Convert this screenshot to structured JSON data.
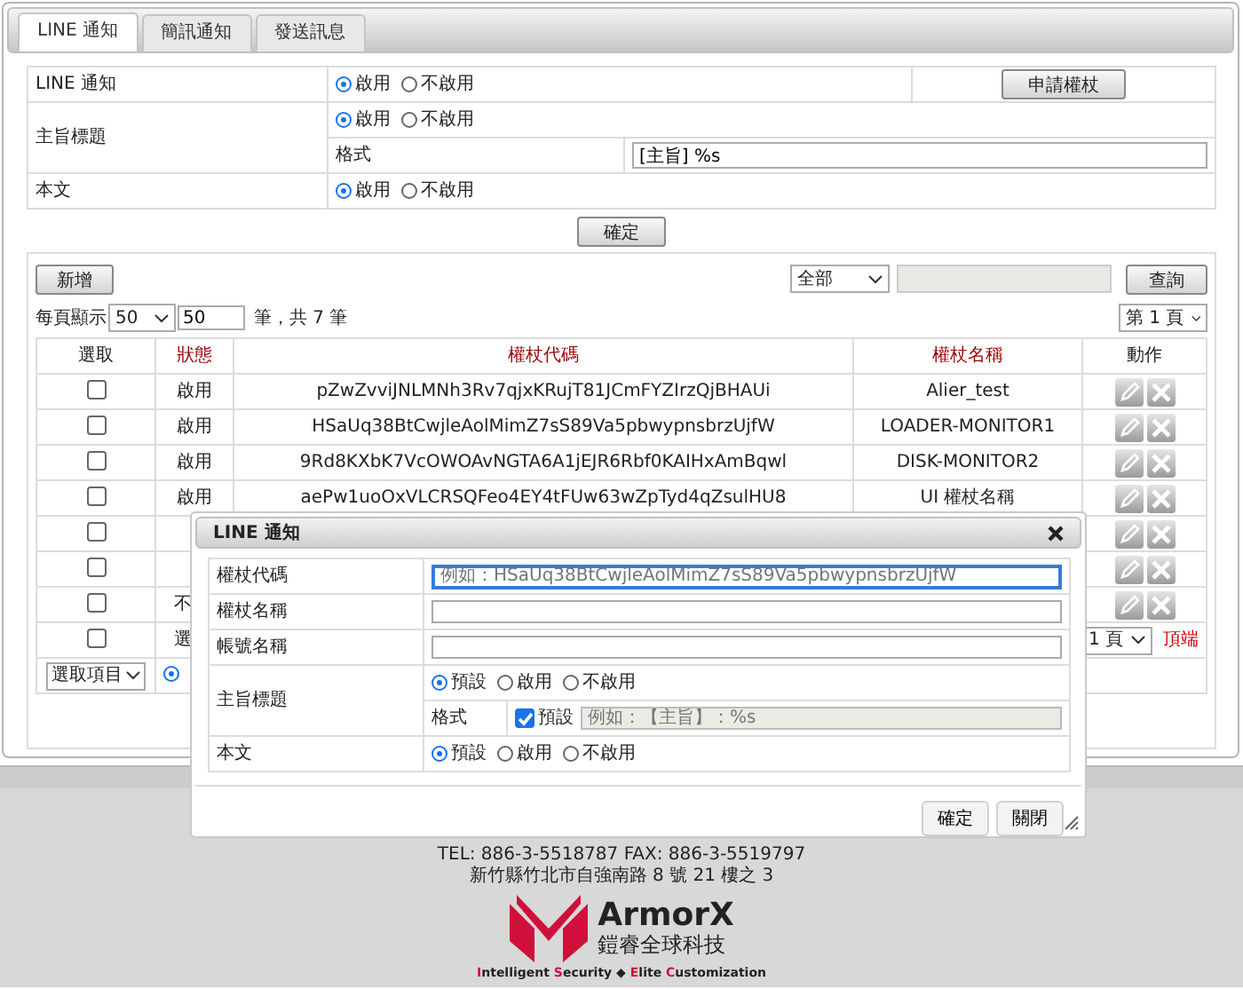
{
  "tabs": [
    {
      "label": "LINE 通知",
      "selected": true
    },
    {
      "label": "簡訊通知",
      "selected": false
    },
    {
      "label": "發送訊息",
      "selected": false
    }
  ],
  "settings": {
    "line_notify": {
      "label": "LINE 通知",
      "options": [
        {
          "label": "啟用",
          "selected": true
        },
        {
          "label": "不啟用",
          "selected": false
        }
      ],
      "button": "申請權杖"
    },
    "subject": {
      "label": "主旨標題",
      "options": [
        {
          "label": "啟用",
          "selected": true
        },
        {
          "label": "不啟用",
          "selected": false
        }
      ],
      "format_label": "格式",
      "format_value": "[主旨] %s"
    },
    "body": {
      "label": "本文",
      "options": [
        {
          "label": "啟用",
          "selected": true
        },
        {
          "label": "不啟用",
          "selected": false
        }
      ]
    },
    "submit": "確定"
  },
  "toolbar": {
    "add": "新增",
    "filter": "全部",
    "query": "查詢"
  },
  "paging": {
    "per_page_label": "每頁顯示",
    "per_page": "50",
    "per_page_input": "50",
    "total": "筆，共 7 筆",
    "page": "第 1 頁"
  },
  "table": {
    "columns": [
      {
        "label": "選取",
        "sortable": false
      },
      {
        "label": "狀態",
        "sortable": true
      },
      {
        "label": "權杖代碼",
        "sortable": true
      },
      {
        "label": "權杖名稱",
        "sortable": true
      },
      {
        "label": "動作",
        "sortable": false
      }
    ],
    "rows": [
      {
        "checked": false,
        "status": "啟用",
        "code": "pZwZvviJNLMNh3Rv7qjxKRujT81JCmFYZIrzQjBHAUi",
        "name": "Alier_test"
      },
      {
        "checked": false,
        "status": "啟用",
        "code": "HSaUq38BtCwjleAolMimZ7sS89Va5pbwypnsbrzUjfW",
        "name": "LOADER-MONITOR1"
      },
      {
        "checked": false,
        "status": "啟用",
        "code": "9Rd8KXbK7VcOWOAvNGTA6A1jEJR6Rbf0KAIHxAmBqwl",
        "name": "DISK-MONITOR2"
      },
      {
        "checked": false,
        "status": "啟用",
        "code": "aePw1uoOxVLCRSQFeo4EY4tFUw63wZpTyd4qZsulHU8",
        "name": "UI 權杖名稱"
      },
      {
        "checked": false
      },
      {
        "checked": false
      },
      {
        "checked": false,
        "status": "不"
      }
    ],
    "footer": {
      "checked": false,
      "select_all": "選",
      "page": "1 頁",
      "top_link": "頂端"
    },
    "bulk": {
      "select": "選取項目",
      "radio_selected": true
    }
  },
  "dialog": {
    "title": "LINE 通知",
    "fields": [
      {
        "label": "權杖代碼",
        "placeholder": "例如：HSaUq38BtCwjleAolMimZ7sS89Va5pbwypnsbrzUjfW",
        "focused": true
      },
      {
        "label": "權杖名稱",
        "focused": false
      },
      {
        "label": "帳號名稱",
        "focused": false
      }
    ],
    "subject": {
      "label": "主旨標題",
      "options": [
        {
          "label": "預設",
          "selected": true
        },
        {
          "label": "啟用",
          "selected": false
        },
        {
          "label": "不啟用",
          "selected": false
        }
      ],
      "format_label": "格式",
      "default_checked": true,
      "default_label": "預設",
      "format_placeholder": "例如：【主旨】：%s"
    },
    "body": {
      "label": "本文",
      "options": [
        {
          "label": "預設",
          "selected": true
        },
        {
          "label": "啟用",
          "selected": false
        },
        {
          "label": "不啟用",
          "selected": false
        }
      ]
    },
    "buttons": [
      "確定",
      "關閉"
    ]
  },
  "footer": {
    "tel": "TEL: 886-3-5518787  FAX: 886-3-5519797",
    "address": "新竹縣竹北市自強南路 8 號 21 樓之 3",
    "brand": "ArmorX",
    "brand_cn": "鎧睿全球科技",
    "tagline": [
      {
        "text": "I",
        "accent": true
      },
      {
        "text": "ntelligent ",
        "accent": false
      },
      {
        "text": "S",
        "accent": true
      },
      {
        "text": "ecurity ◆ ",
        "accent": false
      },
      {
        "text": "E",
        "accent": true
      },
      {
        "text": "lite ",
        "accent": false
      },
      {
        "text": "C",
        "accent": true
      },
      {
        "text": "ustomization",
        "accent": false
      }
    ]
  }
}
